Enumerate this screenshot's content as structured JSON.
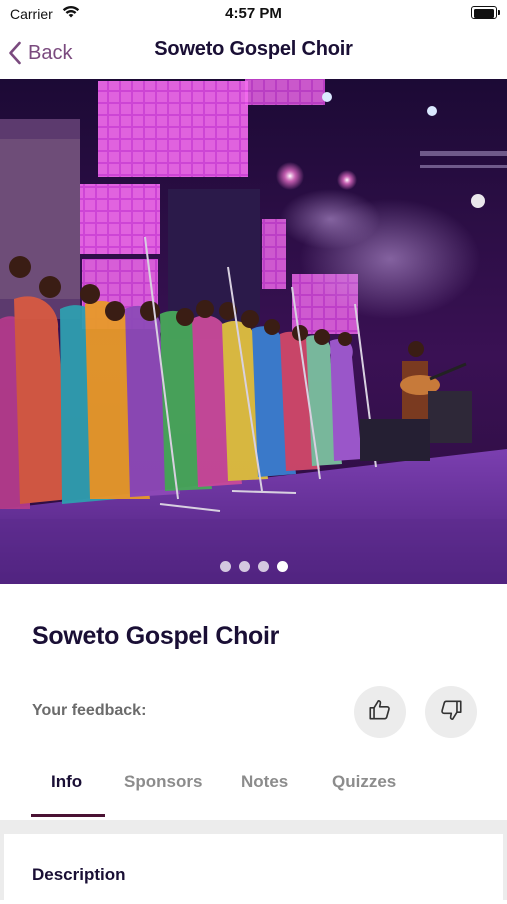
{
  "status_bar": {
    "carrier": "Carrier",
    "time": "4:57 PM",
    "icons": [
      "wifi-icon",
      "battery-icon"
    ]
  },
  "nav": {
    "back_label": "Back",
    "title": "Soweto Gospel Choir"
  },
  "hero": {
    "page_count": 4,
    "active_page": 4
  },
  "content": {
    "title": "Soweto Gospel Choir",
    "feedback_label": "Your feedback:",
    "feedback_icons": [
      "thumbs-up-icon",
      "thumbs-down-icon"
    ],
    "tabs": [
      {
        "label": "Info",
        "active": true
      },
      {
        "label": "Sponsors",
        "active": false
      },
      {
        "label": "Notes",
        "active": false
      },
      {
        "label": "Quizzes",
        "active": false
      }
    ],
    "section_heading": "Description"
  },
  "colors": {
    "accent": "#7a4a7e",
    "title": "#1a0f35",
    "tab_indicator": "#4a1233",
    "muted_text": "#8c8c8c",
    "button_bg": "#ececec"
  }
}
